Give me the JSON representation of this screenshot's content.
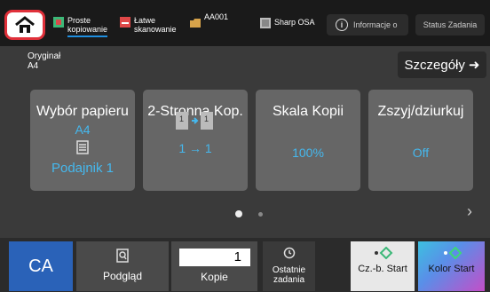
{
  "topbar": {
    "shortcuts": [
      {
        "label": "Proste\nkopiowanie",
        "icon": "copy-icon"
      },
      {
        "label": "Łatwe\nskanowanie",
        "icon": "scan-icon"
      },
      {
        "label": "AA001",
        "icon": "folder-icon"
      },
      {
        "label": "Sharp OSA",
        "icon": "app-icon"
      }
    ],
    "info_label": "Informacje o",
    "status_label": "Status Zadania"
  },
  "original": {
    "line1": "Oryginał",
    "line2": "A4"
  },
  "details_label": "Szczegóły",
  "tiles": [
    {
      "title": "Wybór papieru",
      "value": "A4",
      "sub": "Podajnik 1"
    },
    {
      "title": "2-Stronna Kop.",
      "sub": "1 → 1"
    },
    {
      "title": "Skala Kopii",
      "value": "100%"
    },
    {
      "title": "Zszyj/dziurkuj",
      "value": "Off"
    }
  ],
  "bottom": {
    "ca_label": "CA",
    "preview_label": "Podgląd",
    "copies_label": "Kopie",
    "copies_value": "1",
    "recent_label": "Ostatnie zadania",
    "start_bw_label": "Cz.-b. Start",
    "start_color_label": "Kolor Start"
  },
  "colors": {
    "accent": "#45b8ee",
    "home_border": "#e0303a",
    "ca": "#2a62b8"
  }
}
